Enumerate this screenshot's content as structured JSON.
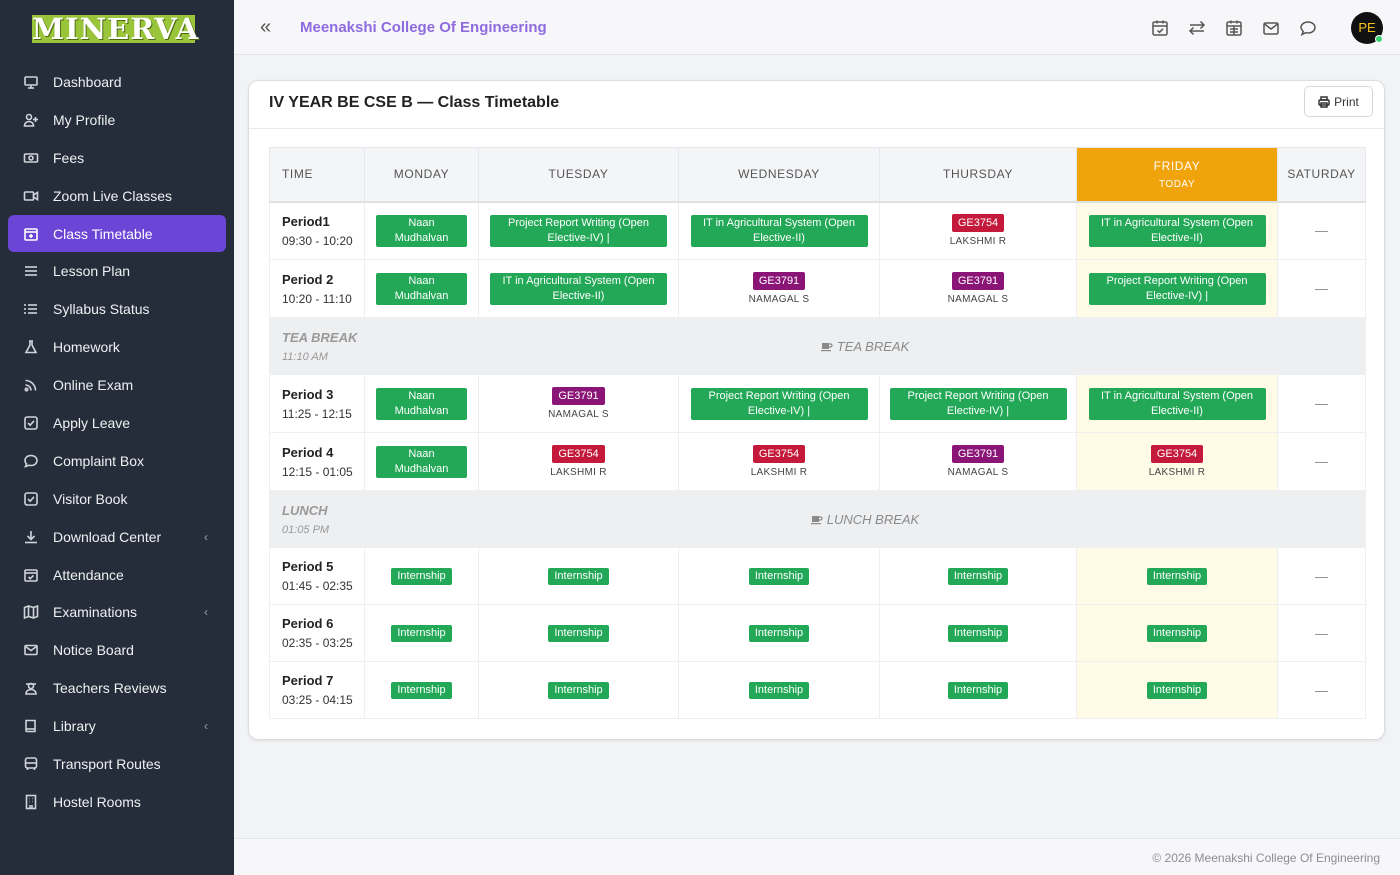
{
  "brand": {
    "logo_text": "MINERVA"
  },
  "sidebar": {
    "items": [
      {
        "label": "Dashboard",
        "icon": "monitor-icon"
      },
      {
        "label": "My Profile",
        "icon": "user-plus-icon"
      },
      {
        "label": "Fees",
        "icon": "money-icon"
      },
      {
        "label": "Zoom Live Classes",
        "icon": "video-icon"
      },
      {
        "label": "Class Timetable",
        "icon": "calendar-plus-icon",
        "active": true
      },
      {
        "label": "Lesson Plan",
        "icon": "list-icon"
      },
      {
        "label": "Syllabus Status",
        "icon": "list-ol-icon"
      },
      {
        "label": "Homework",
        "icon": "flask-icon"
      },
      {
        "label": "Online Exam",
        "icon": "rss-icon"
      },
      {
        "label": "Apply Leave",
        "icon": "check-square-icon"
      },
      {
        "label": "Complaint Box",
        "icon": "comment-icon"
      },
      {
        "label": "Visitor Book",
        "icon": "check-square-icon"
      },
      {
        "label": "Download Center",
        "icon": "download-icon",
        "expandable": true
      },
      {
        "label": "Attendance",
        "icon": "calendar-check-icon"
      },
      {
        "label": "Examinations",
        "icon": "map-icon",
        "expandable": true
      },
      {
        "label": "Notice Board",
        "icon": "envelope-icon"
      },
      {
        "label": "Teachers Reviews",
        "icon": "user-secret-icon"
      },
      {
        "label": "Library",
        "icon": "book-icon",
        "expandable": true
      },
      {
        "label": "Transport Routes",
        "icon": "bus-icon"
      },
      {
        "label": "Hostel Rooms",
        "icon": "building-icon"
      }
    ]
  },
  "topbar": {
    "college_name": "Meenakshi College Of Engineering",
    "avatar_initials": "PE",
    "icons": [
      "calendar-check-icon",
      "exchange-icon",
      "calendar-icon",
      "envelope-icon",
      "chat-icon"
    ]
  },
  "timetable": {
    "title": "IV YEAR BE CSE B — Class Timetable",
    "print_label": "Print",
    "headers": {
      "time": "TIME",
      "days": [
        "MONDAY",
        "TUESDAY",
        "WEDNESDAY",
        "THURSDAY",
        "FRIDAY",
        "SATURDAY"
      ],
      "today_index": 4,
      "today_label": "TODAY"
    },
    "empty_marker": "—",
    "rows": [
      {
        "type": "period",
        "name": "Period1",
        "time": "09:30 - 10:20",
        "cells": [
          {
            "kind": "green",
            "text": "Naan Mudhalvan"
          },
          {
            "kind": "green",
            "text": "Project Report Writing (Open Elective-IV) |"
          },
          {
            "kind": "green",
            "text": "IT in Agricultural System (Open Elective-II)"
          },
          {
            "kind": "code",
            "code": "GE3754",
            "color": "red",
            "teacher": "LAKSHMI R"
          },
          {
            "kind": "green",
            "text": "IT in Agricultural System (Open Elective-II)"
          },
          {
            "kind": "empty"
          }
        ]
      },
      {
        "type": "period",
        "name": "Period 2",
        "time": "10:20 - 11:10",
        "cells": [
          {
            "kind": "green",
            "text": "Naan Mudhalvan"
          },
          {
            "kind": "green",
            "text": "IT in Agricultural System (Open Elective-II)"
          },
          {
            "kind": "code",
            "code": "GE3791",
            "color": "purple",
            "teacher": "NAMAGAL S"
          },
          {
            "kind": "code",
            "code": "GE3791",
            "color": "purple",
            "teacher": "NAMAGAL S"
          },
          {
            "kind": "green",
            "text": "Project Report Writing (Open Elective-IV) |"
          },
          {
            "kind": "empty"
          }
        ]
      },
      {
        "type": "break",
        "name": "TEA BREAK",
        "time": "11:10 AM",
        "center": "TEA BREAK"
      },
      {
        "type": "period",
        "name": "Period 3",
        "time": "11:25 - 12:15",
        "cells": [
          {
            "kind": "green",
            "text": "Naan Mudhalvan"
          },
          {
            "kind": "code",
            "code": "GE3791",
            "color": "purple",
            "teacher": "NAMAGAL S"
          },
          {
            "kind": "green",
            "text": "Project Report Writing (Open Elective-IV) |"
          },
          {
            "kind": "green",
            "text": "Project Report Writing (Open Elective-IV) |"
          },
          {
            "kind": "green",
            "text": "IT in Agricultural System (Open Elective-II)"
          },
          {
            "kind": "empty"
          }
        ]
      },
      {
        "type": "period",
        "name": "Period 4",
        "time": "12:15 - 01:05",
        "cells": [
          {
            "kind": "green",
            "text": "Naan Mudhalvan"
          },
          {
            "kind": "code",
            "code": "GE3754",
            "color": "red",
            "teacher": "LAKSHMI R"
          },
          {
            "kind": "code",
            "code": "GE3754",
            "color": "red",
            "teacher": "LAKSHMI R"
          },
          {
            "kind": "code",
            "code": "GE3791",
            "color": "purple",
            "teacher": "NAMAGAL S"
          },
          {
            "kind": "code",
            "code": "GE3754",
            "color": "red",
            "teacher": "LAKSHMI R"
          },
          {
            "kind": "empty"
          }
        ]
      },
      {
        "type": "break",
        "name": "LUNCH",
        "time": "01:05 PM",
        "center": "LUNCH BREAK"
      },
      {
        "type": "period",
        "name": "Period 5",
        "time": "01:45 - 02:35",
        "cells": [
          {
            "kind": "small",
            "text": "Internship"
          },
          {
            "kind": "small",
            "text": "Internship"
          },
          {
            "kind": "small",
            "text": "Internship"
          },
          {
            "kind": "small",
            "text": "Internship"
          },
          {
            "kind": "small",
            "text": "Internship"
          },
          {
            "kind": "empty"
          }
        ]
      },
      {
        "type": "period",
        "name": "Period 6",
        "time": "02:35 - 03:25",
        "cells": [
          {
            "kind": "small",
            "text": "Internship"
          },
          {
            "kind": "small",
            "text": "Internship"
          },
          {
            "kind": "small",
            "text": "Internship"
          },
          {
            "kind": "small",
            "text": "Internship"
          },
          {
            "kind": "small",
            "text": "Internship"
          },
          {
            "kind": "empty"
          }
        ]
      },
      {
        "type": "period",
        "name": "Period 7",
        "time": "03:25 - 04:15",
        "cells": [
          {
            "kind": "small",
            "text": "Internship"
          },
          {
            "kind": "small",
            "text": "Internship"
          },
          {
            "kind": "small",
            "text": "Internship"
          },
          {
            "kind": "small",
            "text": "Internship"
          },
          {
            "kind": "small",
            "text": "Internship"
          },
          {
            "kind": "empty"
          }
        ]
      }
    ]
  },
  "footer": {
    "text": "© 2026 Meenakshi College Of Engineering"
  },
  "colors": {
    "sidebar_bg": "#262d3a",
    "active": "#6a45d6",
    "today": "#f0a30a",
    "green": "#23a857",
    "code_red": "#c4193a",
    "code_purple": "#8a1576",
    "brand_text": "#8e6bdf"
  }
}
